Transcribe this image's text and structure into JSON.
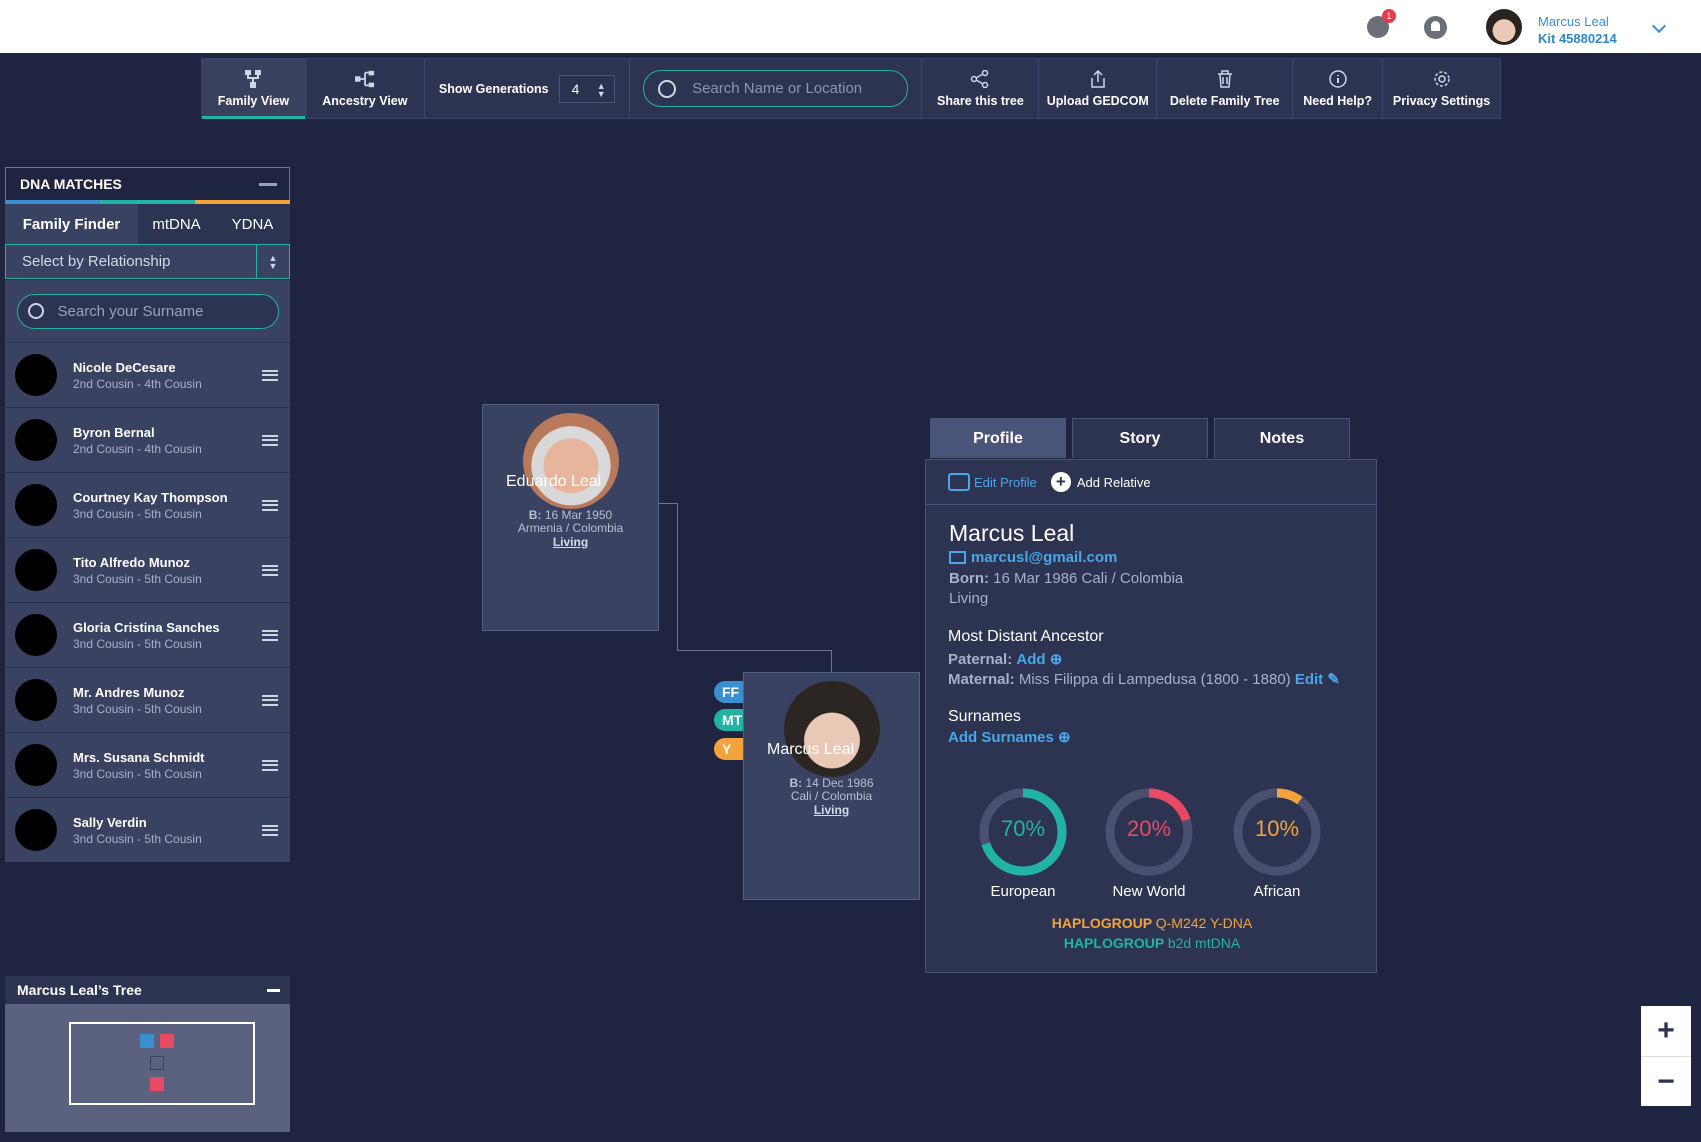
{
  "topbar": {
    "notification_count": "1",
    "user_name": "Marcus Leal",
    "kit": "Kit 45880214"
  },
  "toolbar": {
    "family_view": "Family View",
    "ancestry_view": "Ancestry View",
    "show_generations": "Show Generations",
    "generations_value": "4",
    "search_placeholder": "Search Name or Location",
    "share": "Share this tree",
    "upload": "Upload GEDCOM",
    "delete": "Delete Family Tree",
    "help": "Need Help?",
    "privacy": "Privacy Settings"
  },
  "dna": {
    "title": "DNA MATCHES",
    "tabs": [
      "Family Finder",
      "mtDNA",
      "YDNA"
    ],
    "select_label": "Select by Relationship",
    "surname_placeholder": "Search your Surname",
    "matches": [
      {
        "name": "Nicole DeCesare",
        "relation": "2nd Cousin - 4th Cousin"
      },
      {
        "name": "Byron Bernal",
        "relation": "2nd Cousin - 4th Cousin"
      },
      {
        "name": "Courtney Kay Thompson",
        "relation": "3nd Cousin - 5th Cousin"
      },
      {
        "name": "Tito Alfredo Munoz",
        "relation": "3nd Cousin - 5th Cousin"
      },
      {
        "name": "Gloria Cristina Sanches",
        "relation": "3nd Cousin - 5th Cousin"
      },
      {
        "name": "Mr. Andres Munoz",
        "relation": "3nd Cousin - 5th Cousin"
      },
      {
        "name": "Mrs. Susana Schmidt",
        "relation": "3nd Cousin - 5th Cousin"
      },
      {
        "name": "Sally Verdin",
        "relation": "3nd Cousin - 5th Cousin"
      }
    ]
  },
  "tree_panel": {
    "title": "Marcus Leal’s Tree"
  },
  "father": {
    "name": "Eduardo Leal",
    "born_label": "B:",
    "born": "16 Mar 1950",
    "place": "Armenia / Colombia",
    "status": "Living"
  },
  "self_card": {
    "name": "Marcus Leal",
    "born_label": "B:",
    "born": "14 Dec 1986",
    "place": "Cali / Colombia",
    "status": "Living",
    "badges": [
      "FF",
      "MT",
      "Y"
    ]
  },
  "profile": {
    "tabs": [
      "Profile",
      "Story",
      "Notes"
    ],
    "edit_profile": "Edit Profile",
    "add_relative": "Add Relative",
    "name": "Marcus Leal",
    "email": "marcusl@gmail.com",
    "born_label": "Born:",
    "born": "16 Mar 1986 Cali / Colombia",
    "living": "Living",
    "ancestor_heading": "Most Distant Ancestor",
    "paternal_label": "Paternal:",
    "paternal_action": "Add",
    "maternal_label": "Maternal:",
    "maternal_value": "Miss Filippa di Lampedusa (1800 - 1880)",
    "maternal_action": "Edit",
    "surnames_heading": "Surnames",
    "add_surnames": "Add Surnames",
    "ethnicity": [
      {
        "label": "European",
        "pct": "70%",
        "value": 70,
        "color": "#21b3a3"
      },
      {
        "label": "New World",
        "pct": "20%",
        "value": 20,
        "color": "#e84a64"
      },
      {
        "label": "African",
        "pct": "10%",
        "value": 10,
        "color": "#f3a23c"
      }
    ],
    "haplo1_label": "HAPLOGROUP",
    "haplo1_value": "Q-M242 Y-DNA",
    "haplo2_label": "HAPLOGROUP",
    "haplo2_value": "b2d mtDNA"
  },
  "zoom": {
    "in": "+",
    "out": "−"
  }
}
